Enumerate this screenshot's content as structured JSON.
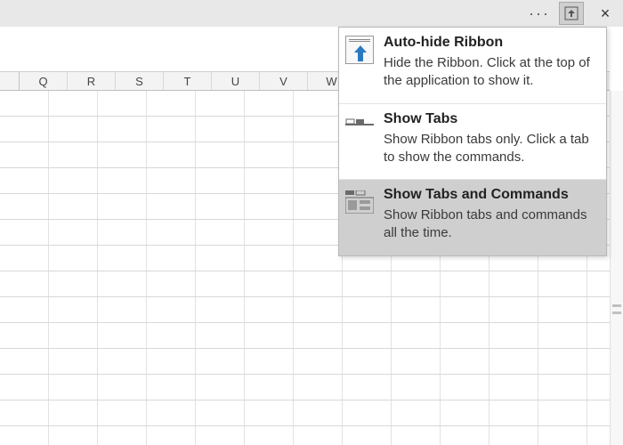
{
  "titlebar": {
    "overflow_label": "···",
    "close_label": "×"
  },
  "columns": [
    "",
    "Q",
    "R",
    "S",
    "T",
    "U",
    "V",
    "W"
  ],
  "menu": {
    "selected_index": 2,
    "items": [
      {
        "icon": "auto-hide-ribbon-icon",
        "title": "Auto-hide Ribbon",
        "desc": "Hide the Ribbon. Click at the top of the application to show it."
      },
      {
        "icon": "show-tabs-icon",
        "title": "Show Tabs",
        "desc": "Show Ribbon tabs only. Click a tab to show the commands."
      },
      {
        "icon": "show-tabs-commands-icon",
        "title": "Show Tabs and Commands",
        "desc": "Show Ribbon tabs and commands all the time."
      }
    ]
  }
}
